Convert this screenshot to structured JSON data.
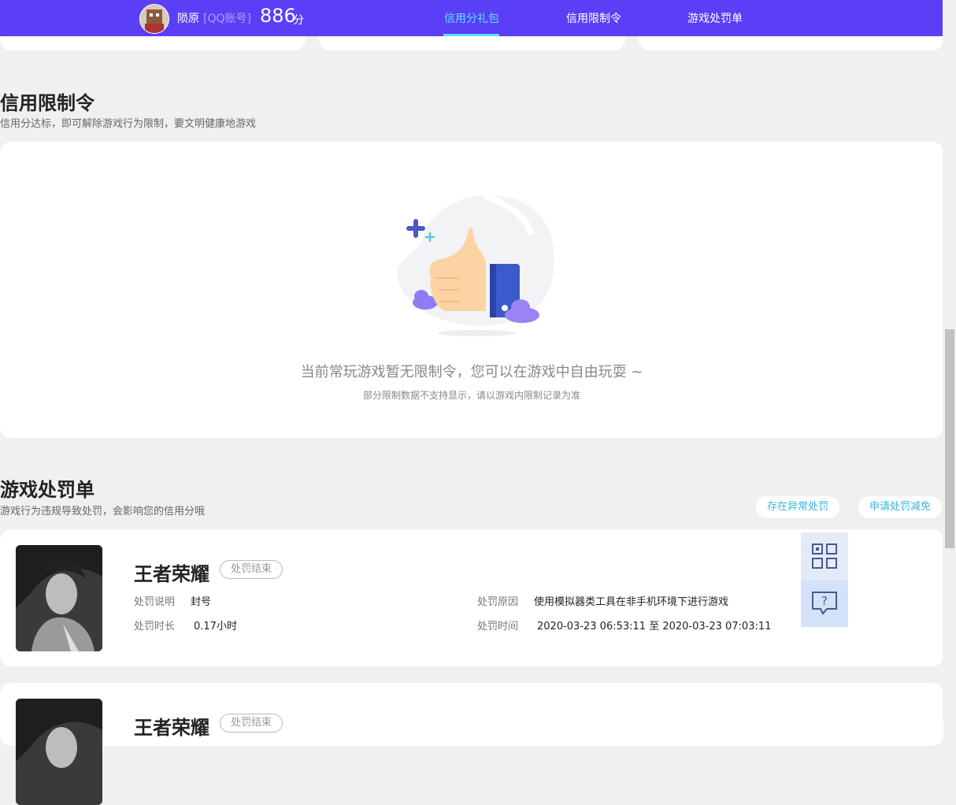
{
  "header": {
    "user_name": "陨原",
    "account_type": "[QQ账号]",
    "score": "886",
    "score_unit": "分",
    "nav": [
      {
        "label": "信用分礼包",
        "active": true
      },
      {
        "label": "信用限制令",
        "active": false
      },
      {
        "label": "游戏处罚单",
        "active": false
      }
    ]
  },
  "restriction": {
    "title": "信用限制令",
    "subtitle": "信用分达标，即可解除游戏行为限制，要文明健康地游戏",
    "empty_main": "当前常玩游戏暂无限制令，您可以在游戏中自由玩耍 ~",
    "empty_sub": "部分限制数据不支持显示，请以游戏内限制记录为准"
  },
  "penalty": {
    "title": "游戏处罚单",
    "subtitle": "游戏行为违规导致处罚，会影响您的信用分哦",
    "buttons": {
      "abnormal": "存在异常处罚",
      "appeal": "申请处罚减免"
    },
    "records": [
      {
        "game": "王者荣耀",
        "status": "处罚结束",
        "desc_label": "处罚说明",
        "desc_value": "封号",
        "duration_label": "处罚时长",
        "duration_value": "0.17小时",
        "reason_label": "处罚原因",
        "reason_value": "使用模拟器类工具在非手机环境下进行游戏",
        "time_label": "处罚时间",
        "time_value": "2020-03-23 06:53:11 至 2020-03-23 07:03:11"
      },
      {
        "game": "王者荣耀",
        "status": "处罚结束"
      }
    ]
  },
  "colors": {
    "brand": "#5b3ff6",
    "accent": "#5ce0ff",
    "link": "#3bb4e0"
  },
  "icons": {
    "qr": "qr-code-icon",
    "help": "help-chat-icon"
  }
}
